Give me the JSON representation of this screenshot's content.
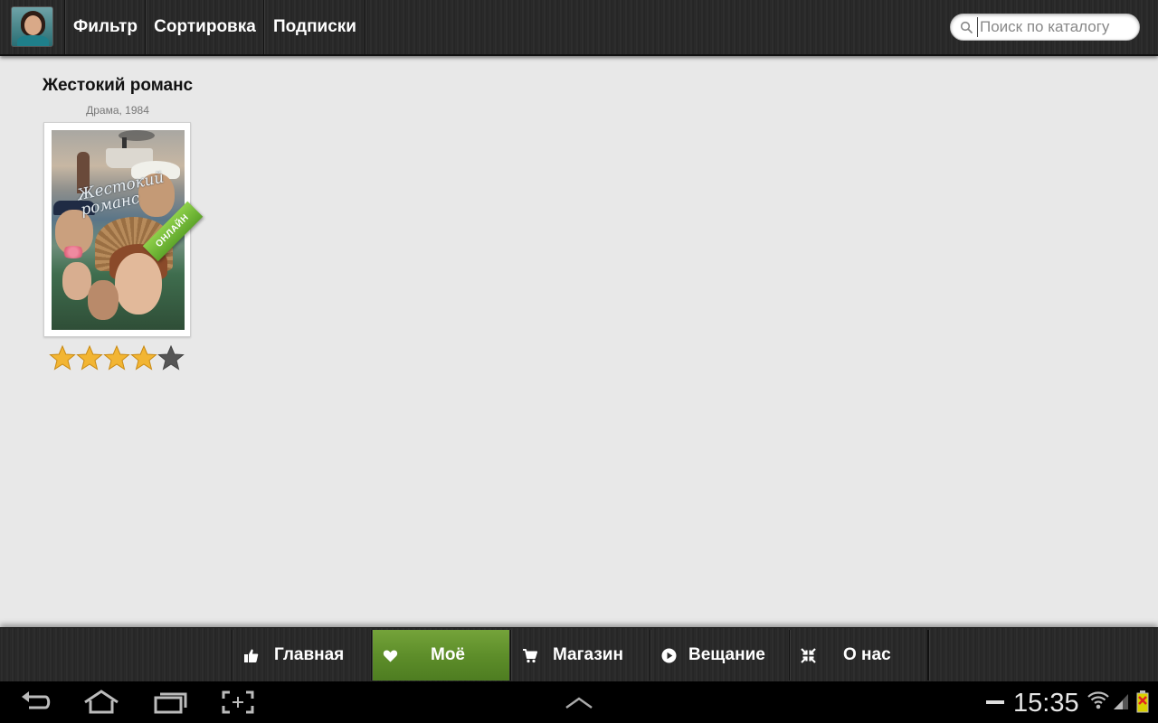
{
  "topbar": {
    "tabs": [
      {
        "label": "Фильтр"
      },
      {
        "label": "Сортировка"
      },
      {
        "label": "Подписки"
      }
    ],
    "search": {
      "placeholder": "Поиск по каталогу",
      "value": ""
    }
  },
  "catalog": {
    "items": [
      {
        "title": "Жестокий романс",
        "subtitle": "Драма, 1984",
        "poster_script": "Жестокий романс",
        "badge": "ОНЛАЙН",
        "rating": 4,
        "rating_max": 5
      }
    ]
  },
  "bottom_nav": {
    "items": [
      {
        "label": "Главная",
        "icon": "thumbs-up-icon",
        "active": false
      },
      {
        "label": "Моё",
        "icon": "heart-icon",
        "active": true
      },
      {
        "label": "Магазин",
        "icon": "cart-icon",
        "active": false
      },
      {
        "label": "Вещание",
        "icon": "play-circle-icon",
        "active": false
      },
      {
        "label": "О нас",
        "icon": "compress-arrows-icon",
        "active": false
      }
    ],
    "active_color": "#5e8e2a"
  },
  "system_bar": {
    "time": "15:35",
    "icons": [
      "back-icon",
      "home-icon",
      "recent-apps-icon",
      "screenshot-icon",
      "up-chevron-icon",
      "minus-icon",
      "wifi-icon",
      "signal-icon",
      "battery-icon"
    ]
  },
  "colors": {
    "accent_green": "#6aa332",
    "star_gold": "#f2b533",
    "star_empty": "#555555",
    "content_bg": "#e8e8e8"
  }
}
